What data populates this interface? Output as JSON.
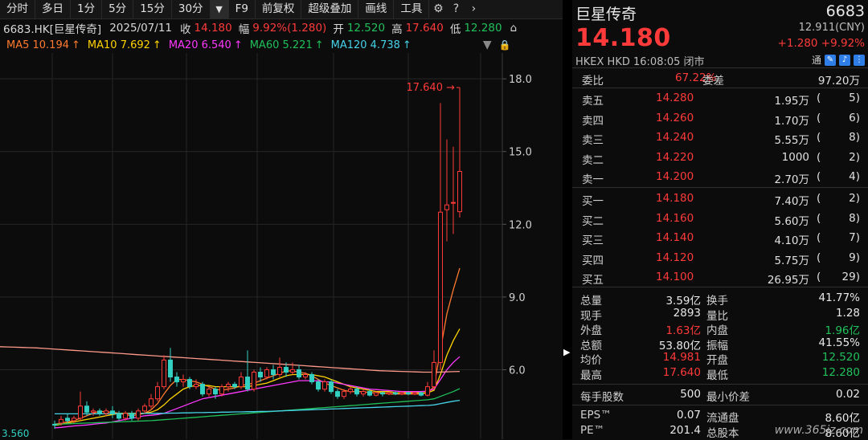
{
  "toolbar": {
    "items": [
      "分时",
      "多日",
      "1分",
      "5分",
      "15分",
      "30分"
    ],
    "dropdown": "▼",
    "items2": [
      "F9",
      "前复权",
      "超级叠加",
      "画线",
      "工具"
    ]
  },
  "info": {
    "code": "6683.HK[巨星传奇]",
    "date": "2025/07/11",
    "close_label": "收",
    "close": "14.180",
    "range_label": "幅",
    "range": "9.92%(1.280)",
    "open_label": "开",
    "open": "12.520",
    "high_label": "高",
    "high": "17.640",
    "low_label": "低",
    "low": "12.280",
    "icon": "⌂"
  },
  "ma": [
    {
      "label": "MA5 10.194",
      "color": "#ff7b2e"
    },
    {
      "label": "MA10 7.692",
      "color": "#ffd400"
    },
    {
      "label": "MA20 6.540",
      "color": "#ff38ff"
    },
    {
      "label": "MA60 5.221",
      "color": "#20c05a"
    },
    {
      "label": "MA120 4.738",
      "color": "#46d3e8"
    }
  ],
  "chart_data": {
    "type": "candlestick",
    "y_ticks": [
      "18.0",
      "15.0",
      "12.0",
      "9.0",
      "6.0"
    ],
    "y_tick_values": [
      18.0,
      15.0,
      12.0,
      9.0,
      6.0
    ],
    "ylim": [
      3.3,
      18.8
    ],
    "high_annotation": "17.640",
    "bottom_left_label": "3.560",
    "candles": [
      {
        "o": 3.75,
        "c": 3.72,
        "h": 3.9,
        "l": 3.56
      },
      {
        "o": 3.8,
        "c": 3.95,
        "h": 4.1,
        "l": 3.7
      },
      {
        "o": 4.0,
        "c": 3.9,
        "h": 4.2,
        "l": 3.8
      },
      {
        "o": 3.9,
        "c": 4.0,
        "h": 4.1,
        "l": 3.8
      },
      {
        "o": 4.0,
        "c": 4.5,
        "h": 5.1,
        "l": 3.9
      },
      {
        "o": 4.5,
        "c": 4.25,
        "h": 4.7,
        "l": 4.1
      },
      {
        "o": 4.25,
        "c": 4.3,
        "h": 4.4,
        "l": 4.1
      },
      {
        "o": 4.3,
        "c": 4.2,
        "h": 4.4,
        "l": 4.1
      },
      {
        "o": 4.2,
        "c": 4.3,
        "h": 4.4,
        "l": 4.1
      },
      {
        "o": 4.3,
        "c": 4.2,
        "h": 4.5,
        "l": 4.0
      },
      {
        "o": 4.2,
        "c": 4.0,
        "h": 4.3,
        "l": 3.9
      },
      {
        "o": 4.0,
        "c": 4.2,
        "h": 4.3,
        "l": 3.9
      },
      {
        "o": 4.2,
        "c": 4.0,
        "h": 4.3,
        "l": 3.9
      },
      {
        "o": 4.0,
        "c": 4.3,
        "h": 4.4,
        "l": 3.9
      },
      {
        "o": 4.3,
        "c": 4.5,
        "h": 4.6,
        "l": 4.2
      },
      {
        "o": 4.5,
        "c": 4.8,
        "h": 5.0,
        "l": 4.4
      },
      {
        "o": 4.8,
        "c": 5.3,
        "h": 5.5,
        "l": 4.7
      },
      {
        "o": 5.3,
        "c": 6.4,
        "h": 6.6,
        "l": 5.2
      },
      {
        "o": 6.4,
        "c": 5.7,
        "h": 6.9,
        "l": 5.5
      },
      {
        "o": 5.7,
        "c": 5.5,
        "h": 5.9,
        "l": 5.3
      },
      {
        "o": 5.5,
        "c": 5.6,
        "h": 5.8,
        "l": 5.3
      },
      {
        "o": 5.6,
        "c": 5.3,
        "h": 5.7,
        "l": 5.2
      },
      {
        "o": 5.3,
        "c": 5.4,
        "h": 5.6,
        "l": 5.2
      },
      {
        "o": 5.4,
        "c": 5.0,
        "h": 5.5,
        "l": 4.9
      },
      {
        "o": 5.0,
        "c": 5.2,
        "h": 5.3,
        "l": 4.9
      },
      {
        "o": 5.2,
        "c": 5.0,
        "h": 5.3,
        "l": 4.8
      },
      {
        "o": 5.0,
        "c": 5.3,
        "h": 5.4,
        "l": 4.9
      },
      {
        "o": 5.3,
        "c": 5.4,
        "h": 5.5,
        "l": 5.1
      },
      {
        "o": 5.4,
        "c": 5.3,
        "h": 5.5,
        "l": 5.2
      },
      {
        "o": 5.3,
        "c": 5.7,
        "h": 5.9,
        "l": 5.2
      },
      {
        "o": 5.7,
        "c": 5.2,
        "h": 6.8,
        "l": 5.1
      },
      {
        "o": 5.2,
        "c": 5.9,
        "h": 6.0,
        "l": 5.1
      },
      {
        "o": 5.9,
        "c": 5.7,
        "h": 6.1,
        "l": 5.5
      },
      {
        "o": 5.7,
        "c": 6.0,
        "h": 6.1,
        "l": 5.6
      },
      {
        "o": 6.0,
        "c": 5.8,
        "h": 6.2,
        "l": 5.6
      },
      {
        "o": 5.8,
        "c": 6.1,
        "h": 6.5,
        "l": 5.7
      },
      {
        "o": 6.1,
        "c": 5.9,
        "h": 6.3,
        "l": 5.7
      },
      {
        "o": 5.9,
        "c": 6.0,
        "h": 6.3,
        "l": 5.8
      },
      {
        "o": 6.0,
        "c": 5.7,
        "h": 6.2,
        "l": 5.6
      },
      {
        "o": 5.7,
        "c": 5.8,
        "h": 5.9,
        "l": 5.6
      },
      {
        "o": 5.8,
        "c": 5.5,
        "h": 5.9,
        "l": 5.4
      },
      {
        "o": 5.5,
        "c": 5.2,
        "h": 5.6,
        "l": 5.1
      },
      {
        "o": 5.2,
        "c": 5.5,
        "h": 5.6,
        "l": 5.1
      },
      {
        "o": 5.5,
        "c": 5.1,
        "h": 5.6,
        "l": 5.0
      },
      {
        "o": 5.1,
        "c": 4.9,
        "h": 5.2,
        "l": 4.8
      },
      {
        "o": 4.9,
        "c": 5.1,
        "h": 5.2,
        "l": 4.8
      },
      {
        "o": 5.1,
        "c": 5.2,
        "h": 5.3,
        "l": 5.0
      },
      {
        "o": 5.2,
        "c": 5.0,
        "h": 5.3,
        "l": 4.9
      },
      {
        "o": 5.0,
        "c": 5.1,
        "h": 5.2,
        "l": 4.9
      },
      {
        "o": 5.1,
        "c": 4.95,
        "h": 5.2,
        "l": 4.9
      },
      {
        "o": 4.95,
        "c": 5.05,
        "h": 5.1,
        "l": 4.9
      },
      {
        "o": 5.05,
        "c": 5.0,
        "h": 5.1,
        "l": 4.9
      },
      {
        "o": 5.0,
        "c": 5.05,
        "h": 5.1,
        "l": 4.95
      },
      {
        "o": 5.05,
        "c": 5.0,
        "h": 5.1,
        "l": 4.95
      },
      {
        "o": 5.0,
        "c": 5.05,
        "h": 5.1,
        "l": 4.95
      },
      {
        "o": 5.05,
        "c": 5.0,
        "h": 5.1,
        "l": 4.95
      },
      {
        "o": 5.0,
        "c": 5.05,
        "h": 5.1,
        "l": 4.95
      },
      {
        "o": 5.05,
        "c": 4.95,
        "h": 5.1,
        "l": 4.9
      },
      {
        "o": 4.95,
        "c": 5.3,
        "h": 5.5,
        "l": 4.9
      },
      {
        "o": 5.3,
        "c": 6.3,
        "h": 6.8,
        "l": 5.2
      },
      {
        "o": 6.3,
        "c": 12.5,
        "h": 17.0,
        "l": 6.0
      },
      {
        "o": 12.6,
        "c": 12.8,
        "h": 15.5,
        "l": 11.3
      },
      {
        "o": 12.9,
        "c": 12.9,
        "h": 15.2,
        "l": 11.6
      },
      {
        "o": 12.52,
        "c": 14.18,
        "h": 17.64,
        "l": 12.28
      }
    ],
    "ma_lines": [
      {
        "name": "MA5",
        "color": "#ff7b2e",
        "values": [
          3.75,
          3.8,
          3.85,
          3.9,
          4.0,
          4.1,
          4.2,
          4.3,
          4.25,
          4.25,
          4.2,
          4.15,
          4.1,
          4.15,
          4.2,
          4.35,
          4.6,
          5.0,
          5.35,
          5.6,
          5.6,
          5.55,
          5.5,
          5.4,
          5.3,
          5.2,
          5.15,
          5.2,
          5.25,
          5.35,
          5.4,
          5.45,
          5.55,
          5.65,
          5.75,
          5.85,
          5.95,
          5.95,
          5.9,
          5.85,
          5.75,
          5.6,
          5.45,
          5.35,
          5.25,
          5.15,
          5.1,
          5.1,
          5.1,
          5.05,
          5.05,
          5.05,
          5.0,
          5.0,
          5.0,
          5.0,
          5.0,
          5.0,
          5.05,
          5.3,
          6.8,
          8.3,
          9.3,
          10.19
        ]
      },
      {
        "name": "MA10",
        "color": "#ffd400",
        "values": [
          3.7,
          3.75,
          3.8,
          3.85,
          3.9,
          3.95,
          4.0,
          4.05,
          4.1,
          4.15,
          4.2,
          4.2,
          4.2,
          4.2,
          4.2,
          4.25,
          4.35,
          4.55,
          4.8,
          5.0,
          5.2,
          5.3,
          5.35,
          5.35,
          5.35,
          5.3,
          5.3,
          5.3,
          5.3,
          5.3,
          5.3,
          5.35,
          5.4,
          5.45,
          5.55,
          5.65,
          5.75,
          5.8,
          5.8,
          5.8,
          5.8,
          5.75,
          5.7,
          5.6,
          5.5,
          5.4,
          5.3,
          5.25,
          5.2,
          5.15,
          5.1,
          5.1,
          5.1,
          5.05,
          5.05,
          5.05,
          5.05,
          5.05,
          5.05,
          5.15,
          5.8,
          6.6,
          7.2,
          7.69
        ]
      },
      {
        "name": "MA20",
        "color": "#ff38ff",
        "values": [
          3.6,
          3.62,
          3.65,
          3.68,
          3.7,
          3.72,
          3.75,
          3.78,
          3.8,
          3.85,
          3.9,
          3.95,
          4.0,
          4.05,
          4.1,
          4.12,
          4.15,
          4.2,
          4.3,
          4.4,
          4.5,
          4.6,
          4.7,
          4.8,
          4.85,
          4.9,
          4.95,
          5.0,
          5.05,
          5.1,
          5.15,
          5.2,
          5.25,
          5.3,
          5.35,
          5.4,
          5.45,
          5.5,
          5.55,
          5.55,
          5.55,
          5.55,
          5.5,
          5.5,
          5.45,
          5.4,
          5.35,
          5.3,
          5.25,
          5.2,
          5.18,
          5.16,
          5.14,
          5.12,
          5.1,
          5.1,
          5.1,
          5.1,
          5.12,
          5.2,
          5.6,
          6.0,
          6.3,
          6.54
        ]
      },
      {
        "name": "MA60",
        "color": "#20c05a",
        "values": [
          3.75,
          3.76,
          3.77,
          3.78,
          3.79,
          3.8,
          3.81,
          3.82,
          3.83,
          3.84,
          3.85,
          3.86,
          3.87,
          3.88,
          3.89,
          3.9,
          3.92,
          3.94,
          3.96,
          3.98,
          4.0,
          4.02,
          4.04,
          4.06,
          4.08,
          4.1,
          4.12,
          4.14,
          4.16,
          4.18,
          4.2,
          4.22,
          4.24,
          4.26,
          4.28,
          4.3,
          4.32,
          4.34,
          4.36,
          4.38,
          4.4,
          4.42,
          4.44,
          4.46,
          4.48,
          4.5,
          4.52,
          4.54,
          4.56,
          4.58,
          4.6,
          4.62,
          4.64,
          4.66,
          4.68,
          4.7,
          4.72,
          4.74,
          4.76,
          4.8,
          4.9,
          5.0,
          5.1,
          5.221
        ]
      },
      {
        "name": "MA120",
        "color": "#46d3e8",
        "values": [
          4.18,
          4.18,
          4.18,
          4.18,
          4.18,
          4.18,
          4.18,
          4.18,
          4.18,
          4.18,
          4.19,
          4.19,
          4.19,
          4.19,
          4.2,
          4.2,
          4.2,
          4.2,
          4.21,
          4.21,
          4.22,
          4.22,
          4.23,
          4.23,
          4.24,
          4.24,
          4.25,
          4.25,
          4.26,
          4.26,
          4.27,
          4.27,
          4.28,
          4.28,
          4.29,
          4.3,
          4.31,
          4.32,
          4.33,
          4.34,
          4.35,
          4.36,
          4.37,
          4.38,
          4.39,
          4.4,
          4.41,
          4.42,
          4.43,
          4.44,
          4.45,
          4.46,
          4.47,
          4.48,
          4.49,
          4.5,
          4.51,
          4.52,
          4.53,
          4.55,
          4.6,
          4.65,
          4.7,
          4.738
        ]
      },
      {
        "name": "MA250",
        "color": "#ff9a8a",
        "values": [
          6.95,
          6.94,
          6.93,
          6.92,
          6.91,
          6.9,
          6.88,
          6.86,
          6.84,
          6.82,
          6.8,
          6.78,
          6.76,
          6.74,
          6.72,
          6.7,
          6.68,
          6.66,
          6.64,
          6.62,
          6.6,
          6.58,
          6.56,
          6.54,
          6.52,
          6.5,
          6.48,
          6.46,
          6.44,
          6.42,
          6.4,
          6.38,
          6.36,
          6.34,
          6.32,
          6.3,
          6.28,
          6.26,
          6.24,
          6.22,
          6.2,
          6.18,
          6.16,
          6.14,
          6.12,
          6.1,
          6.08,
          6.06,
          6.04,
          6.02,
          6.0,
          5.98,
          5.96,
          5.95,
          5.94,
          5.93,
          5.92,
          5.91,
          5.9,
          5.9,
          5.9,
          5.91,
          5.92,
          5.93
        ]
      }
    ]
  },
  "quote": {
    "name": "巨星传奇",
    "code": "6683",
    "price": "14.180",
    "cny": "12.911(CNY)",
    "change": "+1.280 +9.92%",
    "market": "HKEX  HKD  16:08:05  闭市",
    "tong": "通"
  },
  "weibi": {
    "l1": "委比",
    "v1": "67.22%",
    "l2": "委差",
    "v2": "97.20万"
  },
  "book": [
    {
      "label": "卖五",
      "price": "14.280",
      "vol": "1.95万",
      "cnt": "5"
    },
    {
      "label": "卖四",
      "price": "14.260",
      "vol": "1.70万",
      "cnt": "6"
    },
    {
      "label": "卖三",
      "price": "14.240",
      "vol": "5.55万",
      "cnt": "8"
    },
    {
      "label": "卖二",
      "price": "14.220",
      "vol": "1000",
      "cnt": "2"
    },
    {
      "label": "卖一",
      "price": "14.200",
      "vol": "2.70万",
      "cnt": "4"
    },
    {
      "label": "买一",
      "price": "14.180",
      "vol": "7.40万",
      "cnt": "2"
    },
    {
      "label": "买二",
      "price": "14.160",
      "vol": "5.60万",
      "cnt": "8"
    },
    {
      "label": "买三",
      "price": "14.140",
      "vol": "4.10万",
      "cnt": "7"
    },
    {
      "label": "买四",
      "price": "14.120",
      "vol": "5.75万",
      "cnt": "9"
    },
    {
      "label": "买五",
      "price": "14.100",
      "vol": "26.95万",
      "cnt": "29"
    }
  ],
  "stats": [
    {
      "l1": "总量",
      "v1": "3.59亿",
      "c1": "white",
      "l2": "换手",
      "v2": "41.77%",
      "c2": "white"
    },
    {
      "l1": "现手",
      "v1": "2893",
      "c1": "white",
      "l2": "量比",
      "v2": "1.28",
      "c2": "white"
    },
    {
      "l1": "外盘",
      "v1": "1.63亿",
      "c1": "red",
      "l2": "内盘",
      "v2": "1.96亿",
      "c2": "green"
    },
    {
      "l1": "总额",
      "v1": "53.80亿",
      "c1": "white",
      "l2": "振幅",
      "v2": "41.55%",
      "c2": "white"
    },
    {
      "l1": "均价",
      "v1": "14.981",
      "c1": "red",
      "l2": "开盘",
      "v2": "12.520",
      "c2": "green"
    },
    {
      "l1": "最高",
      "v1": "17.640",
      "c1": "red",
      "l2": "最低",
      "v2": "12.280",
      "c2": "green"
    }
  ],
  "stats2": [
    {
      "l1": "每手股数",
      "v1": "500",
      "l2": "最小价差",
      "v2": "0.02"
    }
  ],
  "stats3": [
    {
      "l1": "EPS™",
      "v1": "0.07",
      "l2": "流通盘",
      "v2": "8.60亿"
    },
    {
      "l1": "PE™",
      "v1": "201.4",
      "l2": "总股本",
      "v2": "8.60亿"
    }
  ],
  "watermark": "www.365jz.com"
}
